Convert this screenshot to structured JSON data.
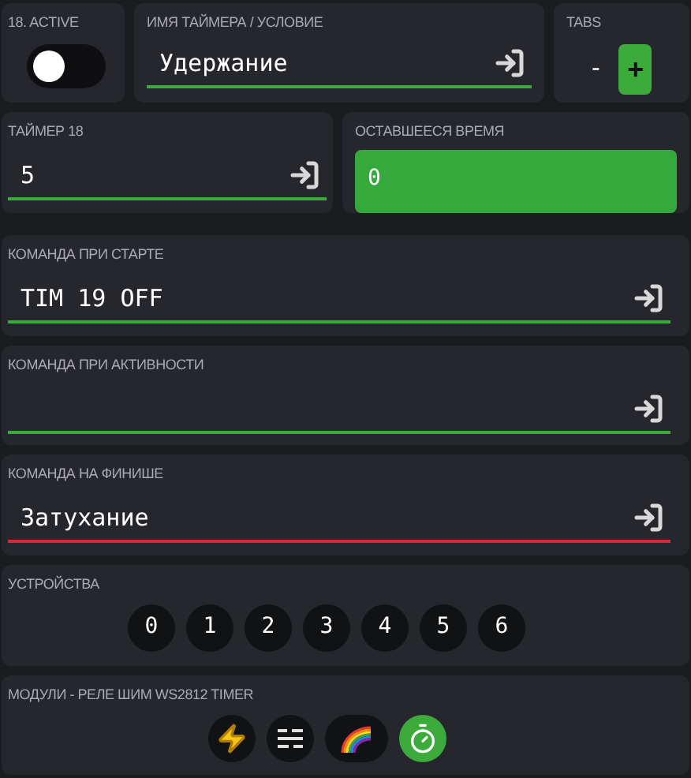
{
  "active": {
    "label": "18. ACTIVE",
    "on": false
  },
  "name_field": {
    "label": "ИМЯ ТАЙМЕРА / УСЛОВИЕ",
    "value": "Удержание",
    "valid": true
  },
  "tabs": {
    "label": "TABS",
    "minus": "-",
    "plus": "+"
  },
  "timer_field": {
    "label": "ТАЙМЕР 18",
    "value": "5",
    "valid": true
  },
  "remaining": {
    "label": "ОСТАВШЕЕСЯ ВРЕМЯ",
    "value": "0"
  },
  "commands": [
    {
      "label": "КОМАНДА ПРИ СТАРТЕ",
      "value": "TIM 19 OFF",
      "valid": true
    },
    {
      "label": "КОМАНДА ПРИ АКТИВНОСТИ",
      "valid": true
    },
    {
      "label": "КОМАНДА НА ФИНИШЕ",
      "value": "Затухание",
      "valid": false
    }
  ],
  "devices": {
    "label": "УСТРОЙСТВА",
    "items": [
      {
        "label": "0",
        "selected": false
      },
      {
        "label": "1",
        "selected": false
      },
      {
        "label": "2",
        "selected": false
      },
      {
        "label": "3",
        "selected": false
      },
      {
        "label": "4",
        "selected": false
      },
      {
        "label": "5",
        "selected": false
      },
      {
        "label": "6",
        "selected": false
      }
    ]
  },
  "modules": {
    "label": "МОДУЛИ - РЕЛЕ ШИМ WS2812 TIMER",
    "items": [
      {
        "kind": "relay",
        "selected": false
      },
      {
        "kind": "pwm",
        "selected": false
      },
      {
        "kind": "ws2812",
        "selected": false
      },
      {
        "kind": "timer",
        "selected": true
      }
    ]
  }
}
